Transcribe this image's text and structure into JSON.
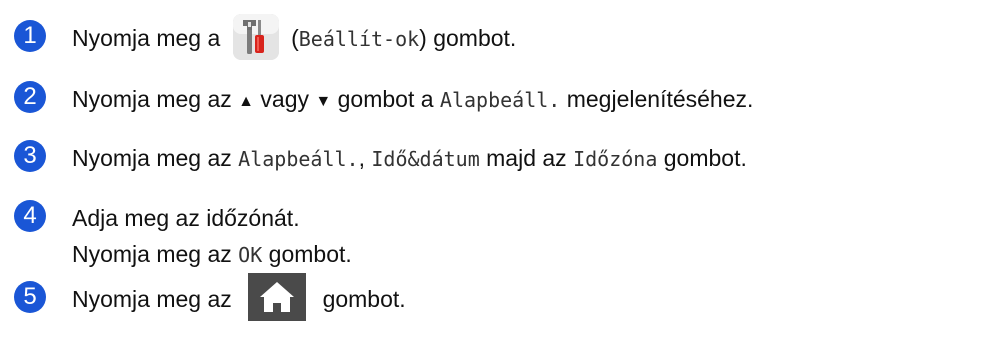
{
  "steps": [
    {
      "num": "1",
      "text_before": "Nyomja meg a",
      "icon": "settings-icon",
      "paren_open": " (",
      "code": "Beállít-ok",
      "paren_close": ")",
      "text_after": " gombot."
    },
    {
      "num": "2",
      "text_before": "Nyomja meg az",
      "up_symbol": "▲",
      "text_mid": "vagy",
      "down_symbol": "▼",
      "text_mid2": "gombot a",
      "code": "Alapbeáll.",
      "text_after": " megjelenítéséhez."
    },
    {
      "num": "3",
      "text_before": "Nyomja meg az",
      "code1": "Alapbeáll.",
      "sep": ",",
      "code2": "Idő&dátum",
      "text_mid": " majd az ",
      "code3": "Időzóna",
      "text_after": " gombot."
    },
    {
      "num": "4",
      "line1": "Adja meg az időzónát.",
      "line2_before": "Nyomja meg az",
      "code": "OK",
      "line2_after": " gombot."
    },
    {
      "num": "5",
      "text_before": "Nyomja meg az",
      "icon": "home-icon",
      "text_after": "gombot."
    }
  ],
  "colors": {
    "badge": "#1a56d6",
    "text": "#111111",
    "home_button_bg": "#4a4a4a",
    "settings_button_bg": "#e6e6e6"
  }
}
